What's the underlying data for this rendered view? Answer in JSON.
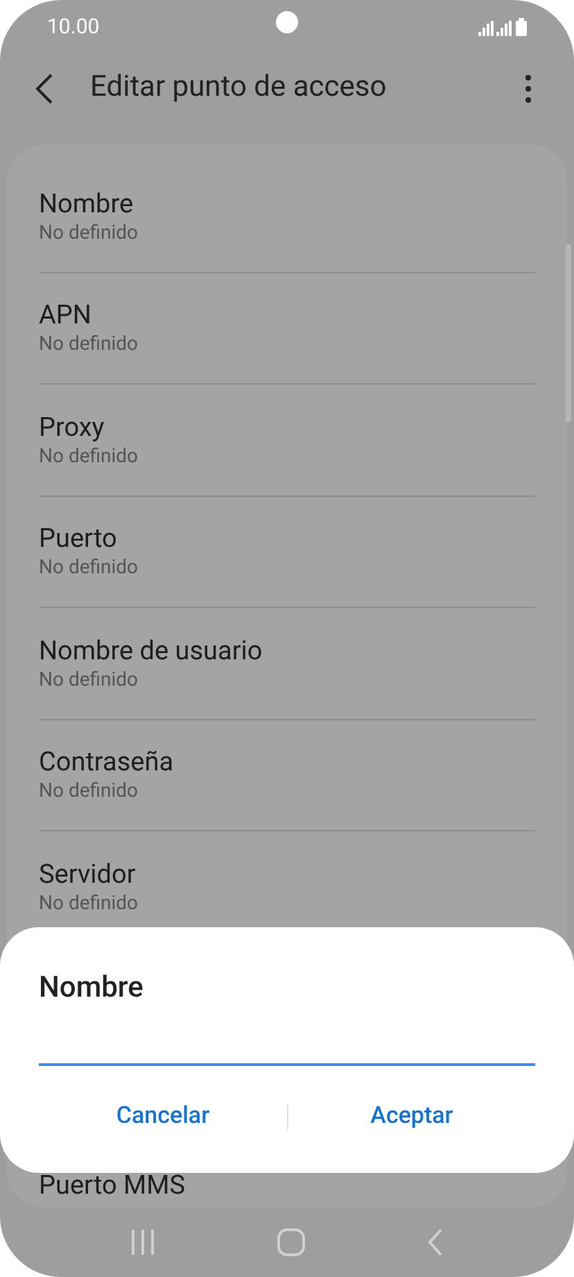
{
  "status_bar": {
    "time": "10.00"
  },
  "header": {
    "title": "Editar punto de acceso"
  },
  "settings": [
    {
      "label": "Nombre",
      "value": "No definido"
    },
    {
      "label": "APN",
      "value": "No definido"
    },
    {
      "label": "Proxy",
      "value": "No definido"
    },
    {
      "label": "Puerto",
      "value": "No definido"
    },
    {
      "label": "Nombre de usuario",
      "value": "No definido"
    },
    {
      "label": "Contraseña",
      "value": "No definido"
    },
    {
      "label": "Servidor",
      "value": "No definido"
    }
  ],
  "partial_setting": {
    "label": "Puerto MMS"
  },
  "dialog": {
    "title": "Nombre",
    "buttons": [
      "Cancelar",
      "Aceptar"
    ]
  }
}
